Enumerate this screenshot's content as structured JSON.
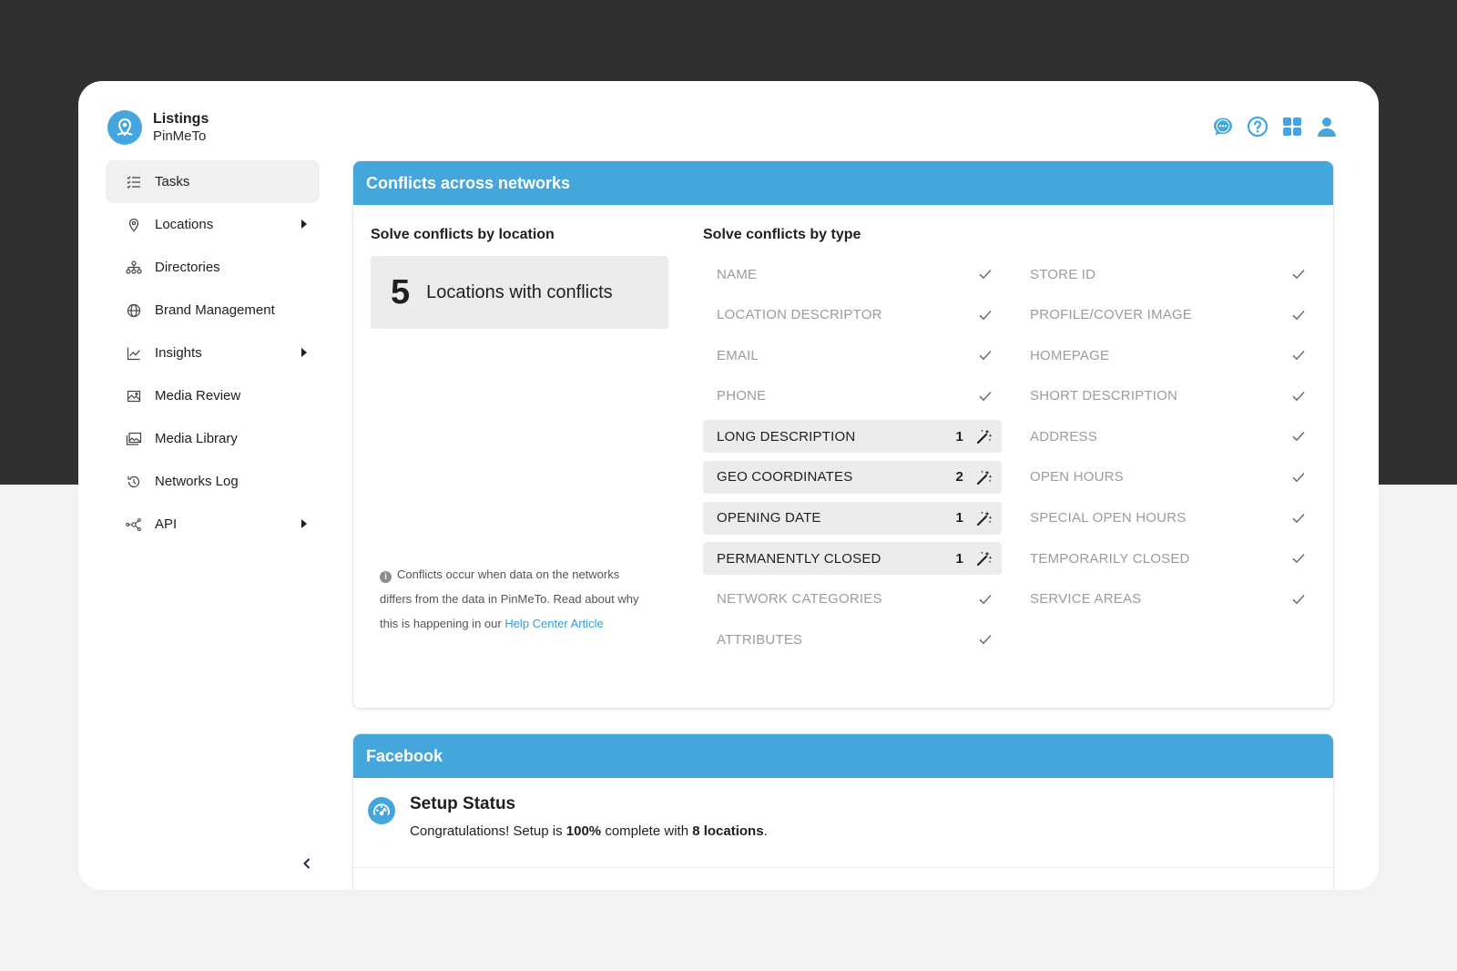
{
  "brand": {
    "title": "Listings",
    "subtitle": "PinMeTo"
  },
  "colors": {
    "accent": "#45a6dc",
    "dark_bg": "#303030",
    "light_bg": "#f1f2f4"
  },
  "sidebar": {
    "items": [
      {
        "label": "Tasks",
        "icon": "tasks-icon",
        "active": true,
        "expandable": false
      },
      {
        "label": "Locations",
        "icon": "location-pin-icon",
        "active": false,
        "expandable": true
      },
      {
        "label": "Directories",
        "icon": "directories-icon",
        "active": false,
        "expandable": false
      },
      {
        "label": "Brand Management",
        "icon": "globe-icon",
        "active": false,
        "expandable": false
      },
      {
        "label": "Insights",
        "icon": "line-chart-icon",
        "active": false,
        "expandable": true
      },
      {
        "label": "Media Review",
        "icon": "image-icon",
        "active": false,
        "expandable": false
      },
      {
        "label": "Media Library",
        "icon": "image-library-icon",
        "active": false,
        "expandable": false
      },
      {
        "label": "Networks Log",
        "icon": "history-icon",
        "active": false,
        "expandable": false
      },
      {
        "label": "API",
        "icon": "api-icon",
        "active": false,
        "expandable": true
      }
    ],
    "collapse_icon": "chevron-left-icon"
  },
  "header_icons": [
    "chat-icon",
    "help-icon",
    "apps-grid-icon",
    "user-icon"
  ],
  "conflicts": {
    "title": "Conflicts across networks",
    "by_location": {
      "title": "Solve conflicts by location",
      "count": "5",
      "label": "Locations with conflicts"
    },
    "note": {
      "text": "Conflicts occur when data on the networks differs from the data in PinMeTo. Read about why this is happening in our ",
      "link": "Help Center Article"
    },
    "by_type": {
      "title": "Solve conflicts by type",
      "left": [
        {
          "name": "NAME",
          "count": null
        },
        {
          "name": "LOCATION DESCRIPTOR",
          "count": null
        },
        {
          "name": "EMAIL",
          "count": null
        },
        {
          "name": "PHONE",
          "count": null
        },
        {
          "name": "LONG DESCRIPTION",
          "count": "1"
        },
        {
          "name": "GEO COORDINATES",
          "count": "2"
        },
        {
          "name": "OPENING DATE",
          "count": "1"
        },
        {
          "name": "PERMANENTLY CLOSED",
          "count": "1"
        },
        {
          "name": "NETWORK CATEGORIES",
          "count": null
        },
        {
          "name": "ATTRIBUTES",
          "count": null
        }
      ],
      "right": [
        {
          "name": "STORE ID",
          "count": null
        },
        {
          "name": "PROFILE/COVER IMAGE",
          "count": null
        },
        {
          "name": "HOMEPAGE",
          "count": null
        },
        {
          "name": "SHORT DESCRIPTION",
          "count": null
        },
        {
          "name": "ADDRESS",
          "count": null
        },
        {
          "name": "OPEN HOURS",
          "count": null
        },
        {
          "name": "SPECIAL OPEN HOURS",
          "count": null
        },
        {
          "name": "TEMPORARILY CLOSED",
          "count": null
        },
        {
          "name": "SERVICE AREAS",
          "count": null
        }
      ]
    }
  },
  "facebook": {
    "title": "Facebook",
    "setup_title": "Setup Status",
    "setup_prefix": "Congratulations! Setup is ",
    "setup_percent": "100%",
    "setup_mid": " complete with ",
    "setup_locations": "8 locations",
    "setup_suffix": "."
  }
}
